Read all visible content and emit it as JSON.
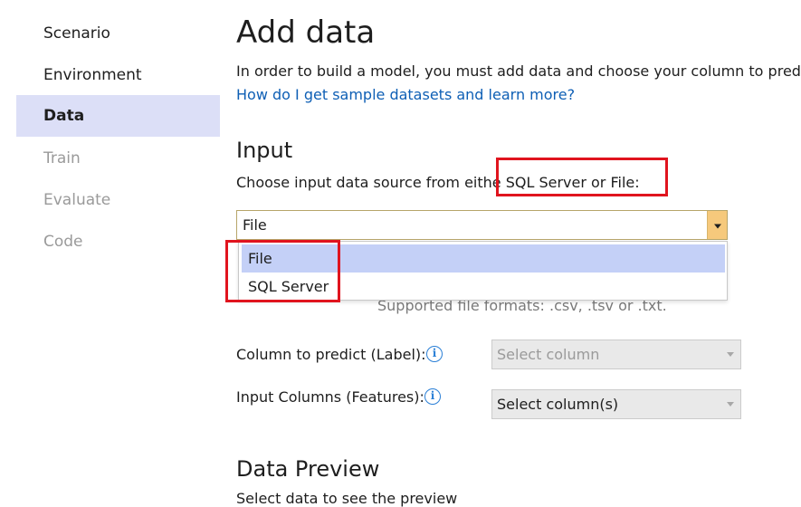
{
  "sidebar": {
    "items": [
      {
        "label": "Scenario"
      },
      {
        "label": "Environment"
      },
      {
        "label": "Data"
      },
      {
        "label": "Train"
      },
      {
        "label": "Evaluate"
      },
      {
        "label": "Code"
      }
    ]
  },
  "main": {
    "title": "Add data",
    "intro": "In order to build a model, you must add data and choose your column to pred",
    "help_link": "How do I get sample datasets and learn more?",
    "input": {
      "heading": "Input",
      "choose_prefix": "Choose input data source from eithe",
      "choose_highlight": " SQL Server or File:",
      "source_select": {
        "value": "File",
        "options": [
          "File",
          "SQL Server"
        ]
      },
      "supported_formats": "Supported file formats: .csv, .tsv or .txt.",
      "label_column": {
        "label": "Column to predict (Label):",
        "placeholder": "Select column"
      },
      "feature_columns": {
        "label": "Input Columns (Features):",
        "value": "Select column(s)"
      }
    },
    "preview": {
      "heading": "Data Preview",
      "subtext": "Select data to see the preview"
    }
  },
  "colors": {
    "active_nav_bg": "#dcdff7",
    "link": "#0e5fb5",
    "highlight_border": "#e0141e",
    "dropdown_arrow": "#f6c97c",
    "selected_option": "#c4d0f7",
    "info_icon": "#2a7fd6"
  },
  "icons": {
    "info": "info-icon",
    "dropdown": "chevron-down-icon"
  }
}
